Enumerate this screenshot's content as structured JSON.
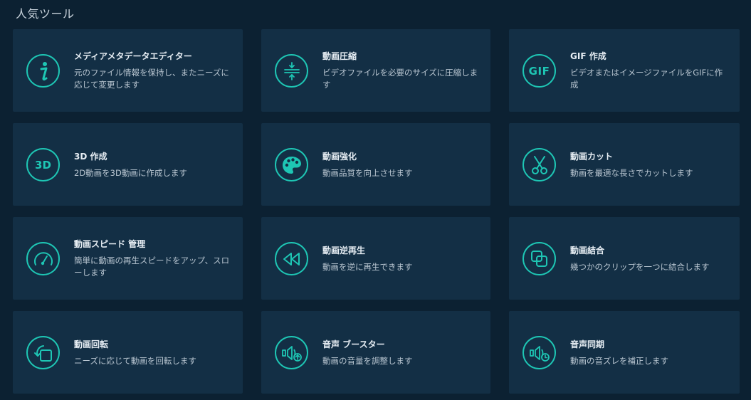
{
  "section_title": "人気ツール",
  "accent_color": "#1ec6b4",
  "tools": [
    {
      "icon": "info-icon",
      "title": "メディアメタデータエディター",
      "desc": "元のファイル情報を保持し、またニーズに応じて変更します"
    },
    {
      "icon": "compress-icon",
      "title": "動画圧縮",
      "desc": "ビデオファイルを必要のサイズに圧縮します"
    },
    {
      "icon": "gif-icon",
      "icon_text": "GIF",
      "title": "GIF 作成",
      "desc": "ビデオまたはイメージファイルをGIFに作成"
    },
    {
      "icon": "3d-icon",
      "icon_text": "3D",
      "title": "3D 作成",
      "desc": "2D動画を3D動画に作成します"
    },
    {
      "icon": "palette-icon",
      "title": "動画強化",
      "desc": "動画品質を向上させます"
    },
    {
      "icon": "scissors-icon",
      "title": "動画カット",
      "desc": "動画を最適な長さでカットします"
    },
    {
      "icon": "speedometer-icon",
      "title": "動画スピード 管理",
      "desc": "簡単に動画の再生スピードをアップ、スローします"
    },
    {
      "icon": "rewind-icon",
      "title": "動画逆再生",
      "desc": "動画を逆に再生できます"
    },
    {
      "icon": "merge-icon",
      "title": "動画結合",
      "desc": "幾つかのクリップを一つに結合します"
    },
    {
      "icon": "rotate-icon",
      "title": "動画回転",
      "desc": "ニーズに応じて動画を回転します"
    },
    {
      "icon": "volume-boost-icon",
      "title": "音声 ブースター",
      "desc": "動画の音量を調整します"
    },
    {
      "icon": "audio-sync-icon",
      "title": "音声同期",
      "desc": "動画の音ズレを補正します"
    }
  ]
}
